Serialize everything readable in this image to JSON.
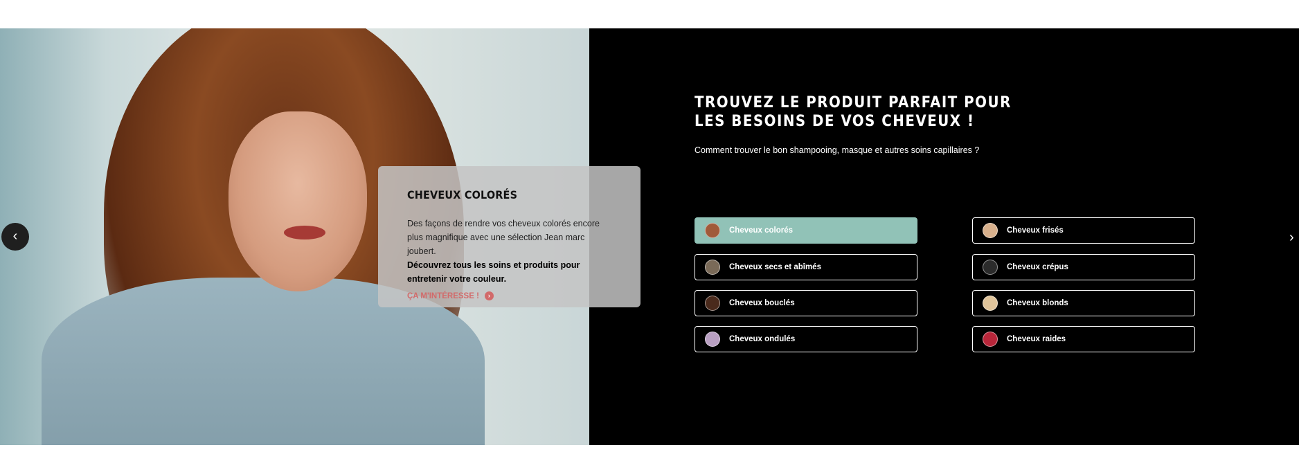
{
  "hero": {
    "headline_line1": "TROUVEZ LE PRODUIT PARFAIT POUR",
    "headline_line2": "LES BESOINS DE VOS CHEVEUX !",
    "subtitle": "Comment trouver le bon shampooing, masque et autres soins capillaires ?"
  },
  "card": {
    "title": "CHEVEUX COLORÉS",
    "text": "Des façons de rendre vos cheveux colorés encore plus magnifique avec une sélection Jean marc joubert.",
    "bold_text": "Découvrez tous les soins et produits pour entretenir votre couleur.",
    "link_label": "ÇA M'INTÉRESSE !",
    "link_icon": "chevron-right-circle-icon"
  },
  "hair_types": [
    {
      "label": "Cheveux colorés",
      "avatar_color": "#a05a3a",
      "active": true
    },
    {
      "label": "Cheveux secs et abîmés",
      "avatar_color": "#7a6a58",
      "active": false
    },
    {
      "label": "Cheveux bouclés",
      "avatar_color": "#4a2a1c",
      "active": false
    },
    {
      "label": "Cheveux ondulés",
      "avatar_color": "#b9a0c2",
      "active": false
    },
    {
      "label": "Cheveux frisés",
      "avatar_color": "#d8b08c",
      "active": false
    },
    {
      "label": "Cheveux crépus",
      "avatar_color": "#2b2b2b",
      "active": false
    },
    {
      "label": "Cheveux blonds",
      "avatar_color": "#e0c49a",
      "active": false
    },
    {
      "label": "Cheveux raides",
      "avatar_color": "#b8263a",
      "active": false
    }
  ],
  "nav": {
    "prev_icon": "chevron-left-icon",
    "next_icon": "chevron-right-icon"
  },
  "colors": {
    "panel_bg": "#000000",
    "active_chip": "#91c2b7",
    "link_accent": "#d26a6a"
  }
}
